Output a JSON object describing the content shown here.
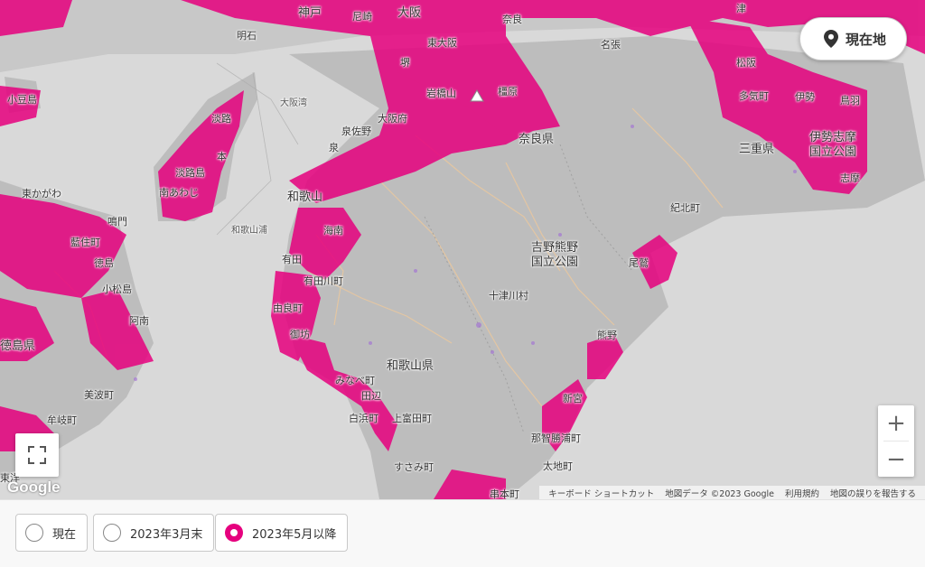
{
  "map": {
    "labels": {
      "kobe": "神戸",
      "amagasaki": "尼崎",
      "osaka": "大阪",
      "nara": "奈良",
      "akashi": "明石",
      "higashiosaka": "東大阪",
      "sakai": "堺",
      "iwahashiyama": "岩橋山",
      "kashihara": "橿原",
      "shodoshima": "小豆島",
      "awaji": "淡路",
      "osakawan": "大阪湾",
      "osakafu": "大阪府",
      "izumisano": "泉佐野",
      "izumi": "泉",
      "narapref": "奈良県",
      "sumoto": "本",
      "awajishima": "淡路島",
      "minamiawaji": "南あわじ",
      "higashikagawa": "東かがわ",
      "naruto": "鳴門",
      "wakayama": "和歌山",
      "wakayamaura": "和歌山浦",
      "kainan": "海南",
      "aizumi": "藍住町",
      "tokushima": "徳島",
      "arida": "有田",
      "aridagawa": "有田川町",
      "komatsushima": "小松島",
      "yura": "由良町",
      "anan": "阿南",
      "gobo": "御坊",
      "tokushimapref": "徳島県",
      "wakayamapref": "和歌山県",
      "minabe": "みなべ町",
      "tanabe": "田辺",
      "shirahama": "白浜町",
      "kamitonda": "上富田町",
      "mihama": "美波町",
      "mugi": "牟岐町",
      "susami": "すさみ町",
      "kushimoto": "串本町",
      "toyo": "東洋",
      "yoshinokumano1": "吉野熊野",
      "yoshinokumano2": "国立公園",
      "totsukawa": "十津川村",
      "kumano": "熊野",
      "owase": "尾鷲",
      "kihoku": "紀北町",
      "shingu": "新宮",
      "nachikatsuura": "那智勝浦町",
      "taiji": "太地町",
      "miepref": "三重県",
      "matsusaka": "松阪",
      "taki": "多気町",
      "ise": "伊勢",
      "toba": "鳥羽",
      "isepark1": "伊勢志摩",
      "isepark2": "国立公園",
      "shima": "志摩",
      "tsu": "津",
      "nabari": "名張"
    },
    "current_location_label": "現在地",
    "zoom_in": "+",
    "zoom_out": "−",
    "google_logo": "Google",
    "attribution": {
      "shortcuts": "キーボード ショートカット",
      "map_data": "地図データ ©2023 Google",
      "terms": "利用規約",
      "report": "地図の誤りを報告する"
    },
    "icons": {
      "location": "map-pin-icon",
      "fullscreen": "fullscreen-icon"
    },
    "colors": {
      "coverage": "#e6007e",
      "land": "#bdbdbd",
      "sea": "#d9d9d9"
    }
  },
  "period_options": {
    "current": "現在",
    "march_2023": "2023年3月末",
    "may_2023": "2023年5月以降",
    "selected": "may_2023"
  }
}
